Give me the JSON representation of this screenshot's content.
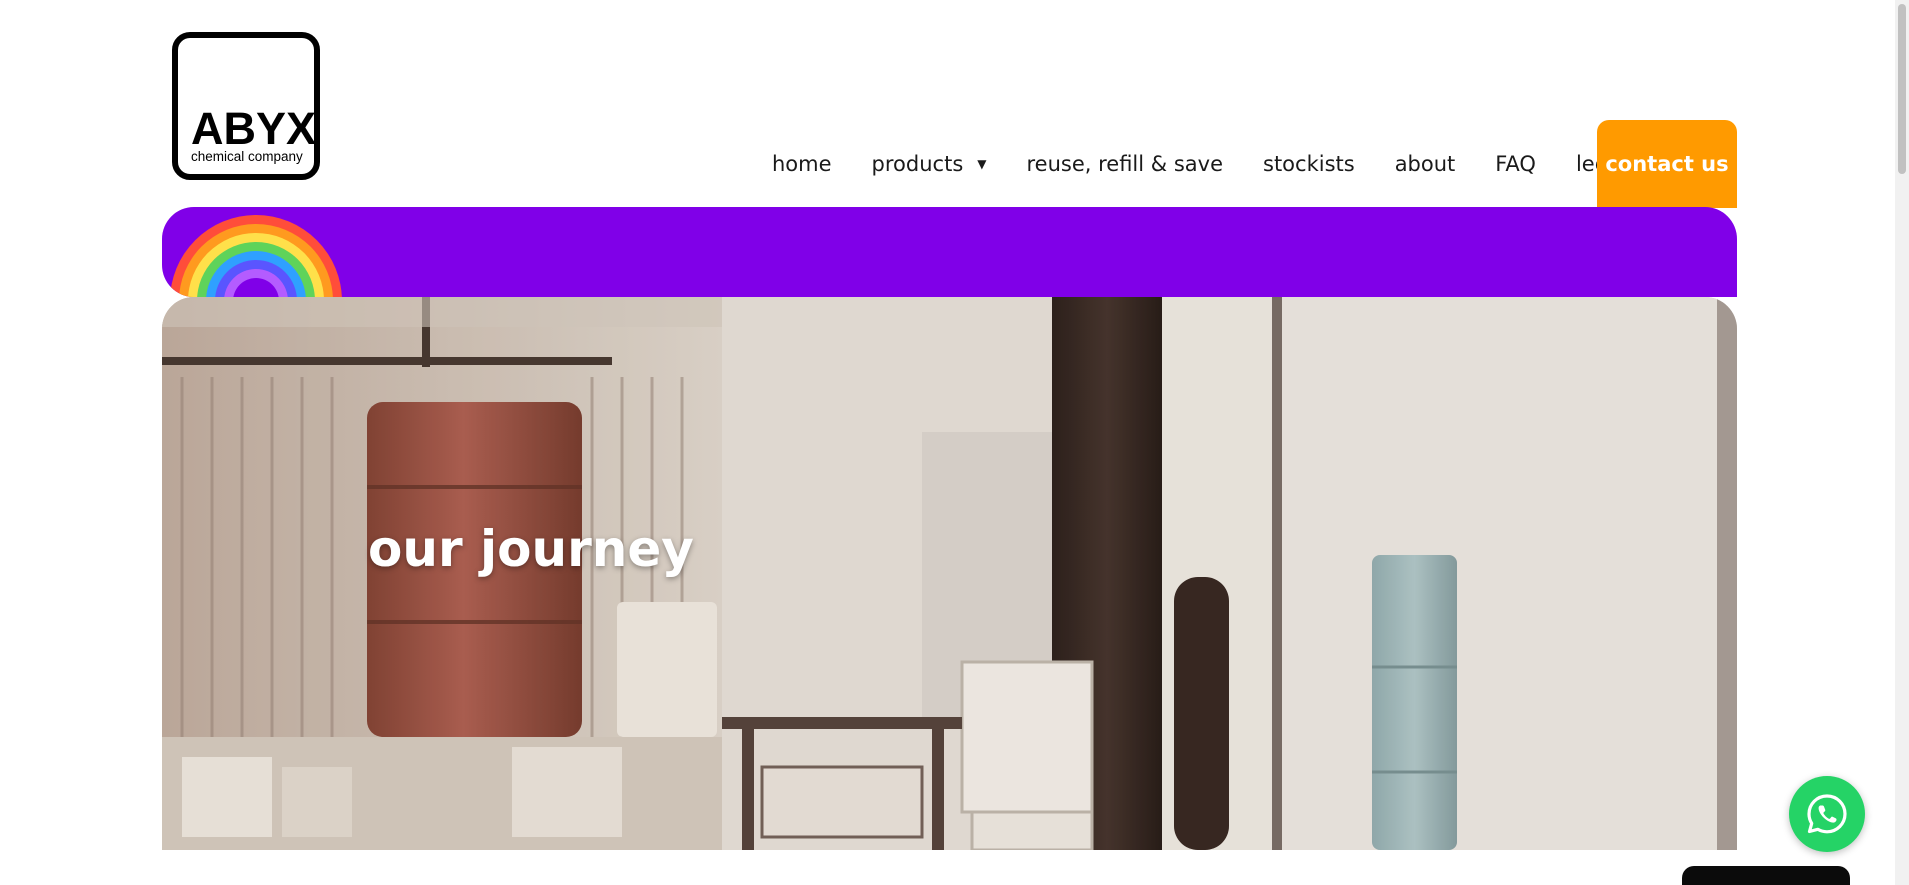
{
  "logo": {
    "word": "ABYX",
    "subtitle": "chemical company"
  },
  "nav": {
    "items": [
      {
        "label": "home"
      },
      {
        "label": "products",
        "has_dropdown": true
      },
      {
        "label": "reuse, refill & save"
      },
      {
        "label": "stockists"
      },
      {
        "label": "about"
      },
      {
        "label": "FAQ"
      },
      {
        "label": "legal"
      }
    ],
    "cta_label": "contact us"
  },
  "hero": {
    "title": "our journey"
  },
  "colors": {
    "banner": "#8000e8",
    "cta": "#ff9a00",
    "whatsapp": "#25d366"
  },
  "icons": {
    "rainbow": "rainbow-icon",
    "products_caret": "caret-down-icon",
    "whatsapp": "whatsapp-icon"
  }
}
